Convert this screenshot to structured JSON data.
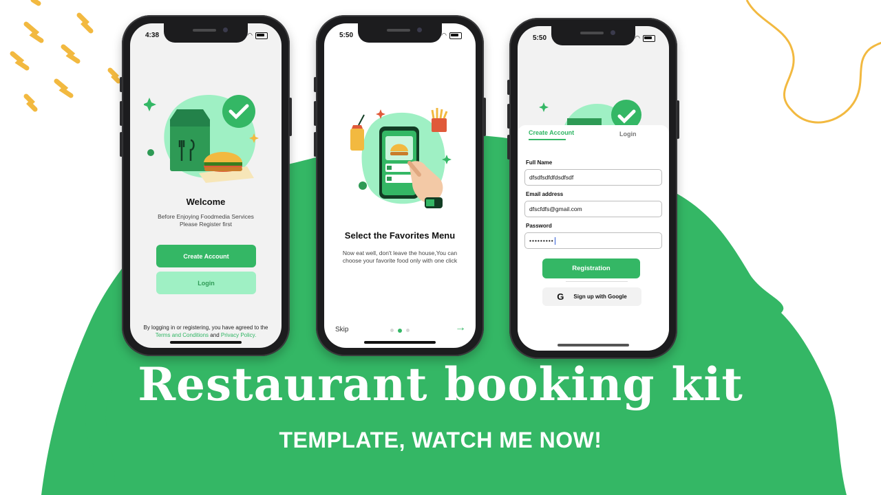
{
  "colors": {
    "brand": "#34B765",
    "brand_light": "#9FF0C4",
    "accent_yellow": "#F2B940",
    "bg": "#FFFFFF"
  },
  "headline": "Restaurant booking kit",
  "subline": "TEMPLATE, WATCH ME NOW!",
  "phone1": {
    "time": "4:38",
    "title": "Welcome",
    "subtitle_line1": "Before Enjoying Foodmedia Services",
    "subtitle_line2": "Please Register first",
    "create_account": "Create Account",
    "login": "Login",
    "terms_prefix": "By logging in or registering, you have agreed to the",
    "terms_link": "Terms and Conditions",
    "terms_and": "and",
    "privacy_link": "Privacy Policy."
  },
  "phone2": {
    "time": "5:50",
    "title": "Select the Favorites Menu",
    "subtitle_line1": "Now eat well, don't leave the house,You can",
    "subtitle_line2": "choose your favorite food only with one click",
    "skip": "Skip",
    "page_dots": 3,
    "active_dot": 2,
    "next_icon": "arrow-right-icon"
  },
  "phone3": {
    "time": "5:50",
    "tabs": [
      {
        "label": "Create Account",
        "active": true
      },
      {
        "label": "Login",
        "active": false
      }
    ],
    "full_name_label": "Full Name",
    "full_name_value": "dfsdfsdfdfdsdfsdf",
    "email_label": "Email address",
    "email_value": "dfscfdfs@gmail.com",
    "password_label": "Password",
    "password_value": "•••••••••",
    "register_button": "Registration",
    "google_button": "Sign up with Google",
    "google_icon": "google-g-icon"
  }
}
